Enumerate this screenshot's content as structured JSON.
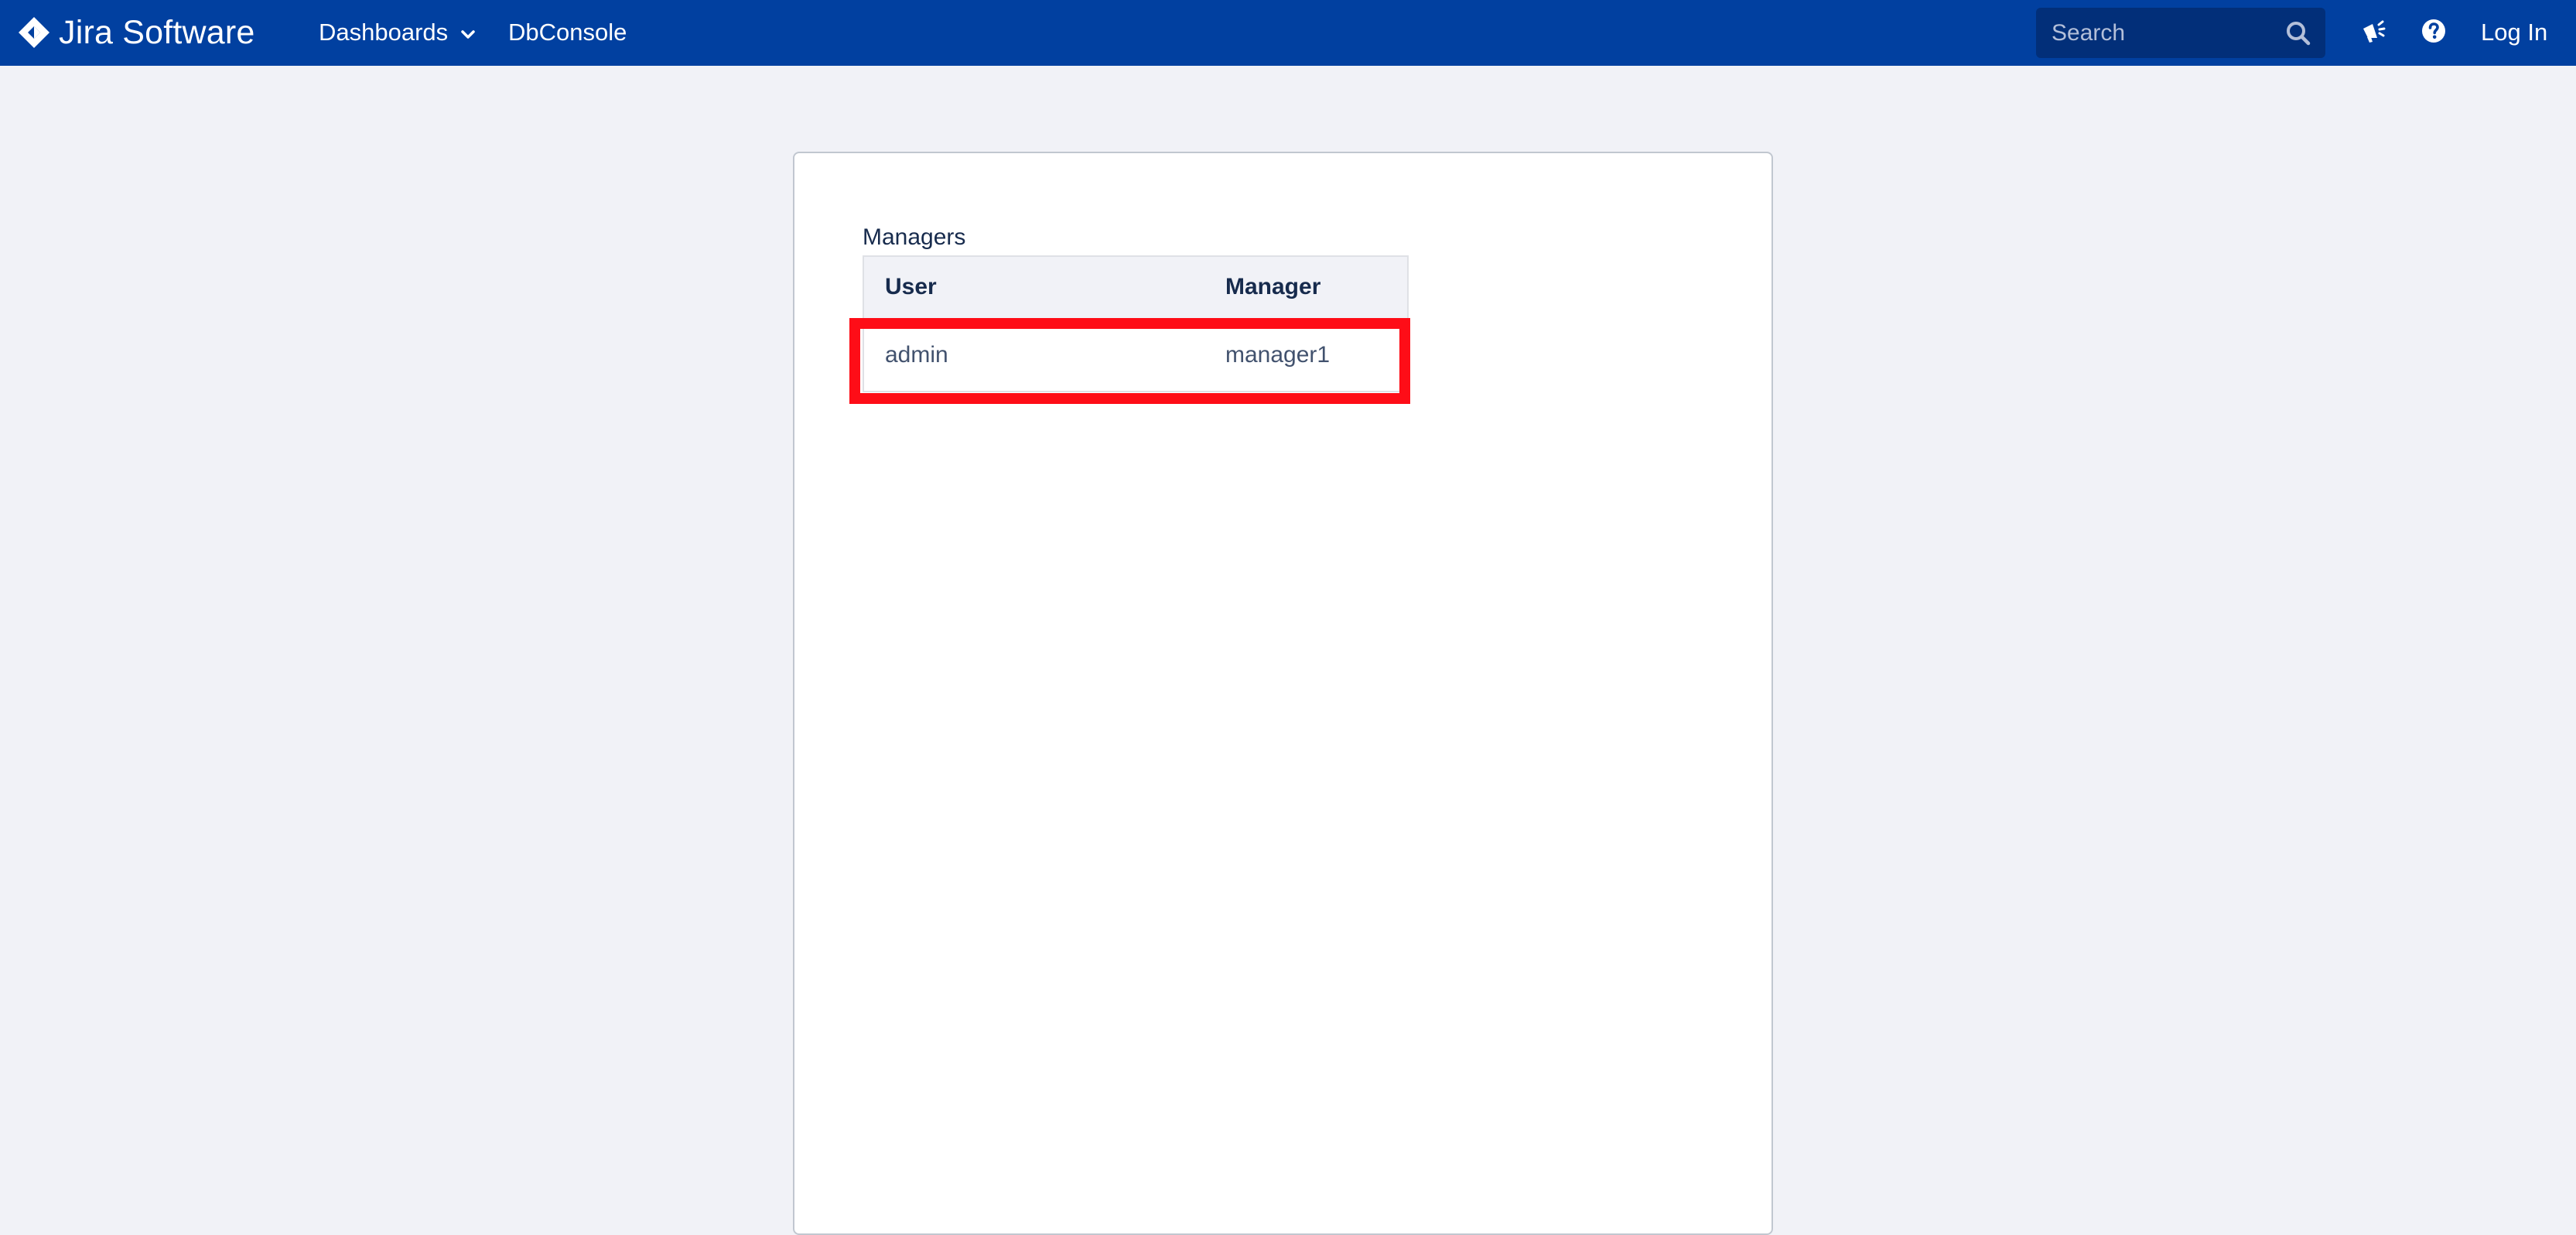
{
  "header": {
    "product_name": "Jira Software",
    "nav": {
      "dashboards_label": "Dashboards",
      "dbconsole_label": "DbConsole"
    },
    "search": {
      "placeholder": "Search",
      "value": ""
    },
    "login_label": "Log In",
    "icons": {
      "logo": "jira-diamond-icon",
      "dashboards_menu": "chevron-down-icon",
      "search": "search-icon",
      "announcements": "megaphone-icon",
      "help": "help-icon"
    }
  },
  "main": {
    "table_caption": "Managers",
    "columns": [
      "User",
      "Manager"
    ],
    "rows": [
      {
        "user": "admin",
        "manager": "manager1"
      }
    ]
  },
  "colors": {
    "header_bg": "#0140a0",
    "search_bg": "#022f79",
    "page_bg": "#f1f2f7",
    "highlight": "#fe0d17"
  }
}
